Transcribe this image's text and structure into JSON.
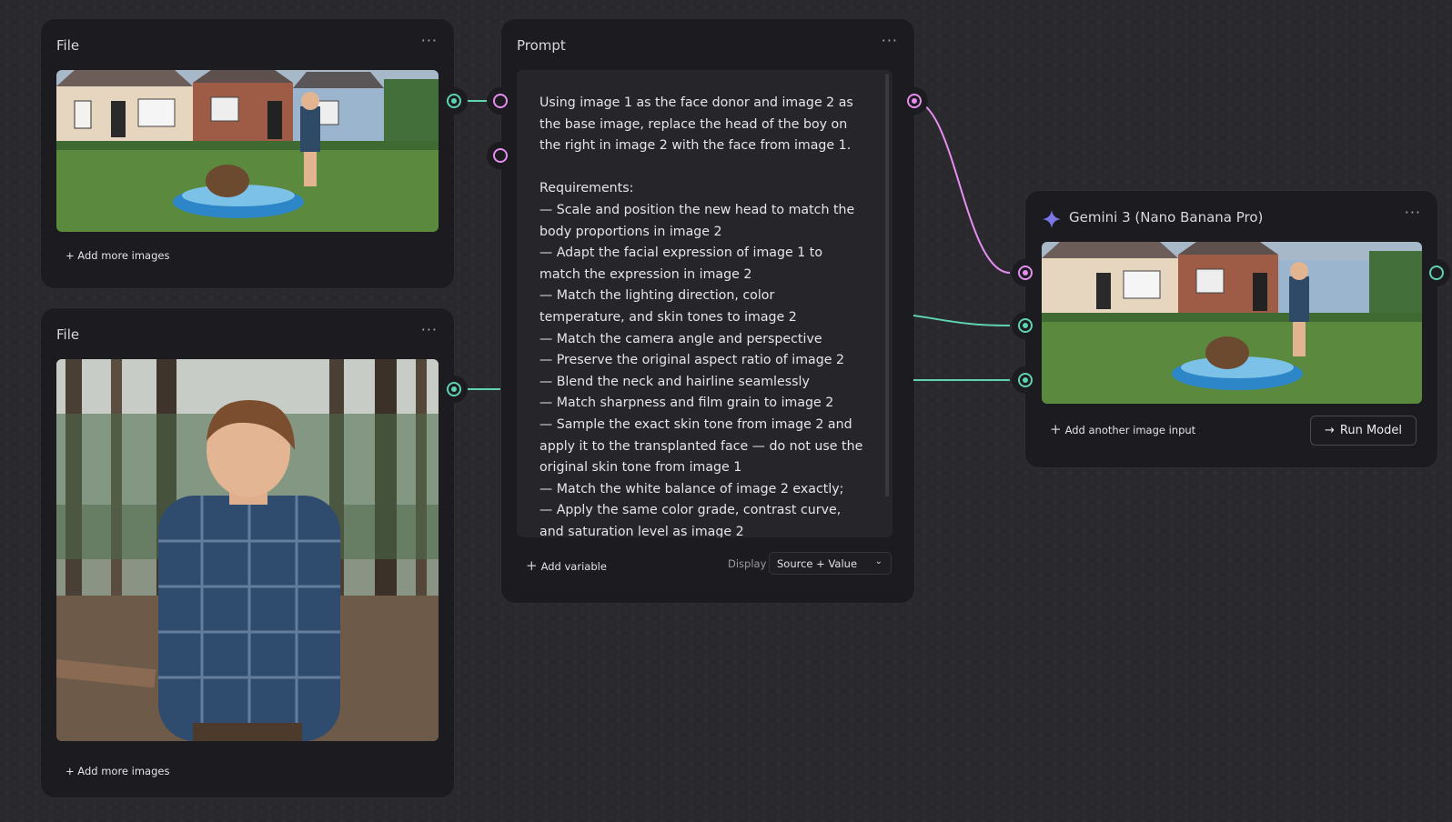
{
  "colors": {
    "canvas": "#2a292e",
    "node": "#1c1b1f",
    "accent_green": "#5fd3b0",
    "accent_pink": "#e58ef0",
    "gemini_star": "#7b77e6"
  },
  "file1": {
    "title": "File",
    "add_label": "+ Add more images",
    "image": "backyard: boy spraying hose at beaver in blue kiddie pool"
  },
  "file2": {
    "title": "File",
    "add_label": "+ Add more images",
    "image": "boy in plaid shirt standing in pine forest"
  },
  "prompt": {
    "title": "Prompt",
    "text": "Using image 1 as the face donor and image 2 as the base image, replace the head of the boy on the right in image 2 with the face from image 1.\n\nRequirements:\n— Scale and position the new head to match the body proportions in image 2\n— Adapt the facial expression of image 1 to match the expression in image 2\n— Match the lighting direction, color temperature, and skin tones to image 2\n— Match the camera angle and perspective\n— Preserve the original aspect ratio of image 2\n— Blend the neck and hairline seamlessly\n— Match sharpness and film grain to image 2\n— Sample the exact skin tone from image 2 and apply it to the transplanted face — do not use the original skin tone from image 1\n— Match the white balance of image 2 exactly;\n— Apply the same color grade, contrast curve, and saturation level as image 2",
    "add_variable": "Add variable",
    "display_label": "Display",
    "display_value": "Source + Value"
  },
  "model": {
    "title": "Gemini 3 (Nano Banana Pro)",
    "add_input": "Add another image input",
    "run_label": "Run Model",
    "image": "backyard output image with boy and beaver in kiddie pool"
  }
}
